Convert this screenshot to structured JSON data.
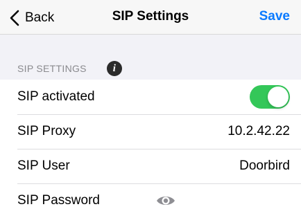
{
  "navbar": {
    "back_label": "Back",
    "title": "SIP Settings",
    "save_label": "Save"
  },
  "section": {
    "header": "SIP SETTINGS",
    "info_icon": "i"
  },
  "rows": [
    {
      "label": "SIP activated",
      "toggle_on": true
    },
    {
      "label": "SIP Proxy",
      "value": "10.2.42.22"
    },
    {
      "label": "SIP User",
      "value": "Doorbird"
    },
    {
      "label": "SIP Password",
      "icon": "eye-icon"
    }
  ],
  "colors": {
    "accent": "#0a7aff",
    "toggle_on": "#34c759",
    "background": "#f2f2f7"
  }
}
